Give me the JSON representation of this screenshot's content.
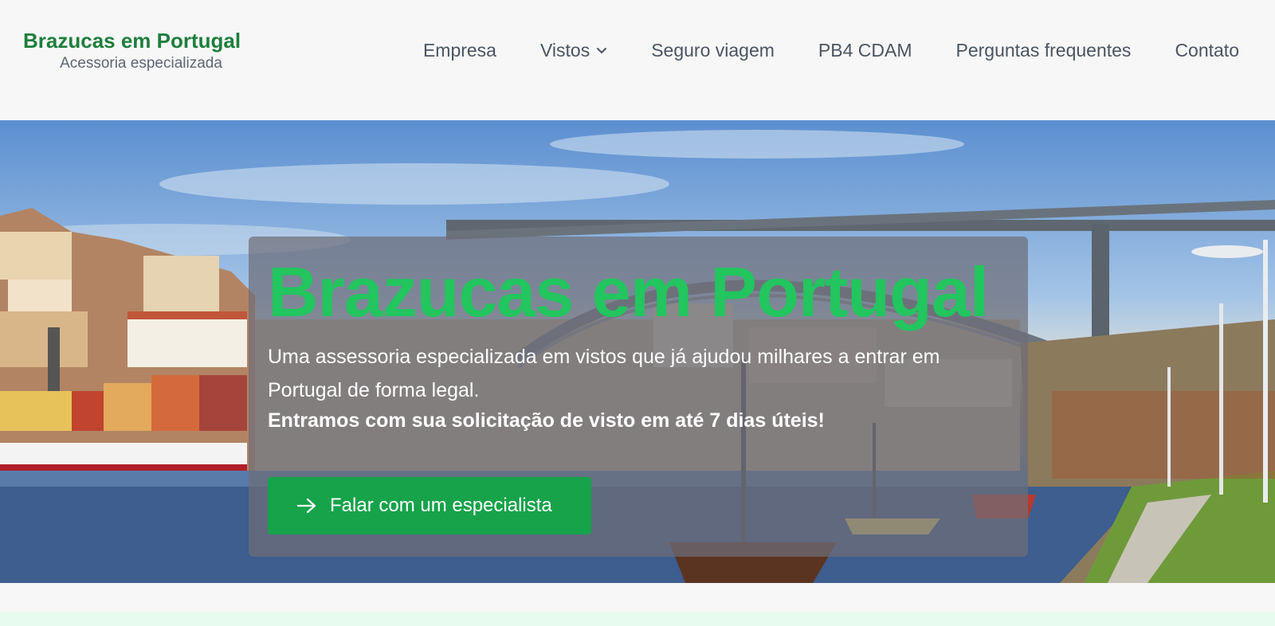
{
  "brand": {
    "title": "Brazucas em Portugal",
    "tagline": "Acessoria especializada"
  },
  "nav": {
    "items": [
      {
        "label": "Empresa",
        "has_dropdown": false
      },
      {
        "label": "Vistos",
        "has_dropdown": true
      },
      {
        "label": "Seguro viagem",
        "has_dropdown": false
      },
      {
        "label": "PB4 CDAM",
        "has_dropdown": false
      },
      {
        "label": "Perguntas frequentes",
        "has_dropdown": false
      },
      {
        "label": "Contato",
        "has_dropdown": false
      }
    ]
  },
  "hero": {
    "title": "Brazucas em Portugal",
    "text": "Uma assessoria especializada em vistos que já ajudou milhares a entrar em Portugal de forma legal.",
    "emphasis": "Entramos com sua solicitação de visto em até 7 dias úteis!",
    "cta_label": "Falar com um especialista",
    "cta_icon": "arrow-right-icon"
  },
  "colors": {
    "brand_green": "#1e7e3c",
    "hero_title_green": "#22c55e",
    "cta_green": "#16a34a",
    "nav_text": "#4a5462"
  }
}
